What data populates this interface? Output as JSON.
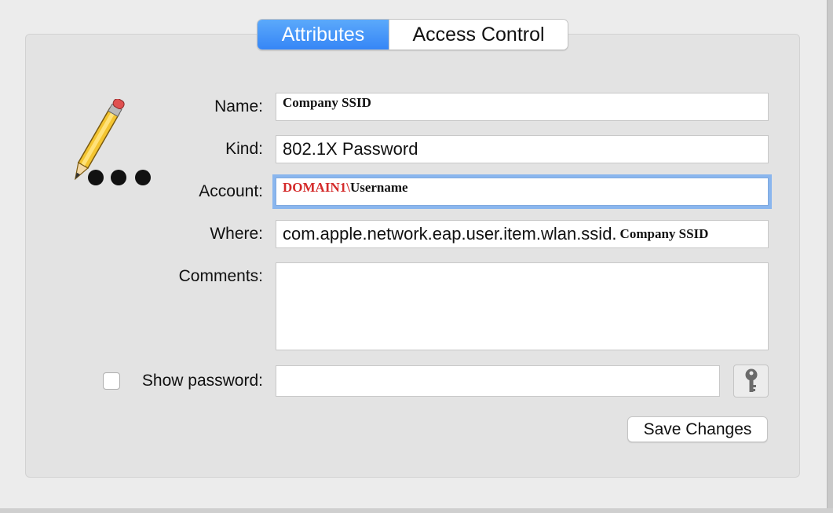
{
  "tabs": [
    {
      "label": "Attributes",
      "active": true
    },
    {
      "label": "Access Control",
      "active": false
    }
  ],
  "icon": "pencil-dots-icon",
  "fields": {
    "name": {
      "label": "Name:",
      "value": "Company SSID"
    },
    "kind": {
      "label": "Kind:",
      "value": "802.1X Password"
    },
    "account": {
      "label": "Account:",
      "domain": "DOMAIN1\\",
      "user": "Username"
    },
    "where": {
      "label": "Where:",
      "prefix": "com.apple.network.eap.user.item.wlan.ssid.",
      "ssid": "Company SSID"
    },
    "comments": {
      "label": "Comments:",
      "value": ""
    }
  },
  "show_password": {
    "label": "Show password:",
    "checked": false,
    "value": ""
  },
  "key_button_icon": "key-icon",
  "save_button": "Save Changes",
  "colors": {
    "accent": "#3686f6",
    "focus_ring": "#8ab6ee",
    "redacted_domain": "#d42a2a"
  }
}
